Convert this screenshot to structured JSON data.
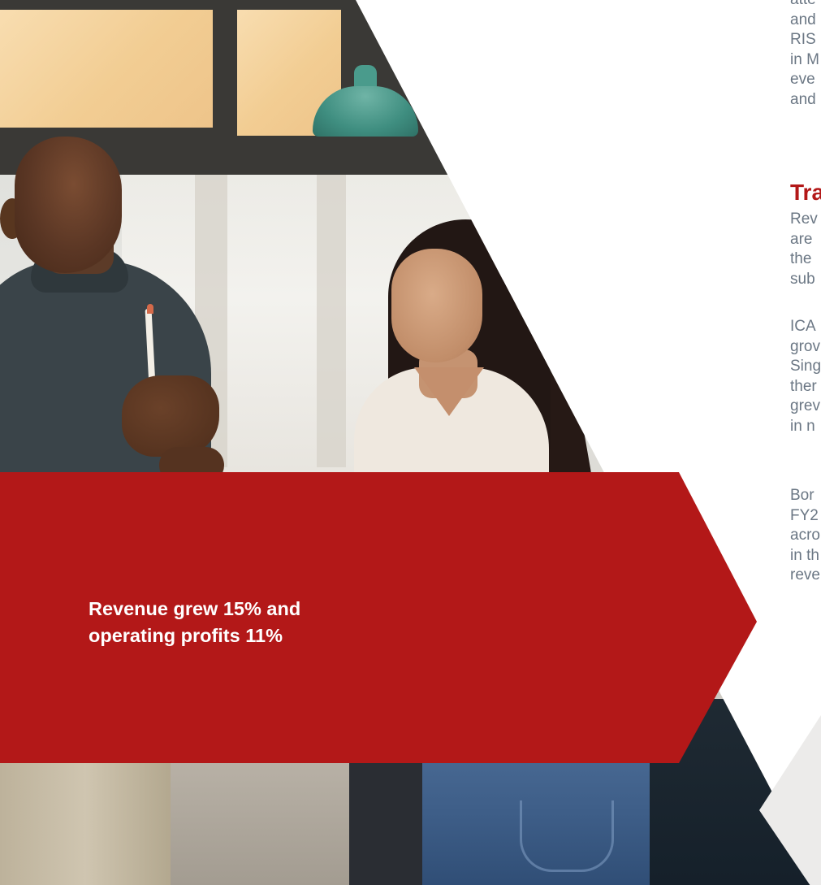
{
  "banner": {
    "line1": "Revenue grew 15% and",
    "line2": "operating profits 11%"
  },
  "column": {
    "intro_lines": [
      "atte",
      "and",
      "RIS",
      "in M",
      "eve",
      "and"
    ],
    "heading": "Tra",
    "para1_lines": [
      "Rev",
      "are",
      "the",
      "sub"
    ],
    "para2_lines": [
      "ICA",
      "grov",
      "Sing",
      "ther",
      "grev",
      "in n"
    ],
    "para3_lines": [
      "Bor",
      "FY2",
      "acro",
      "in th",
      "reve"
    ]
  },
  "colors": {
    "accent_red": "#b31818",
    "body_text": "#6b7784",
    "background": "#ffffff"
  }
}
